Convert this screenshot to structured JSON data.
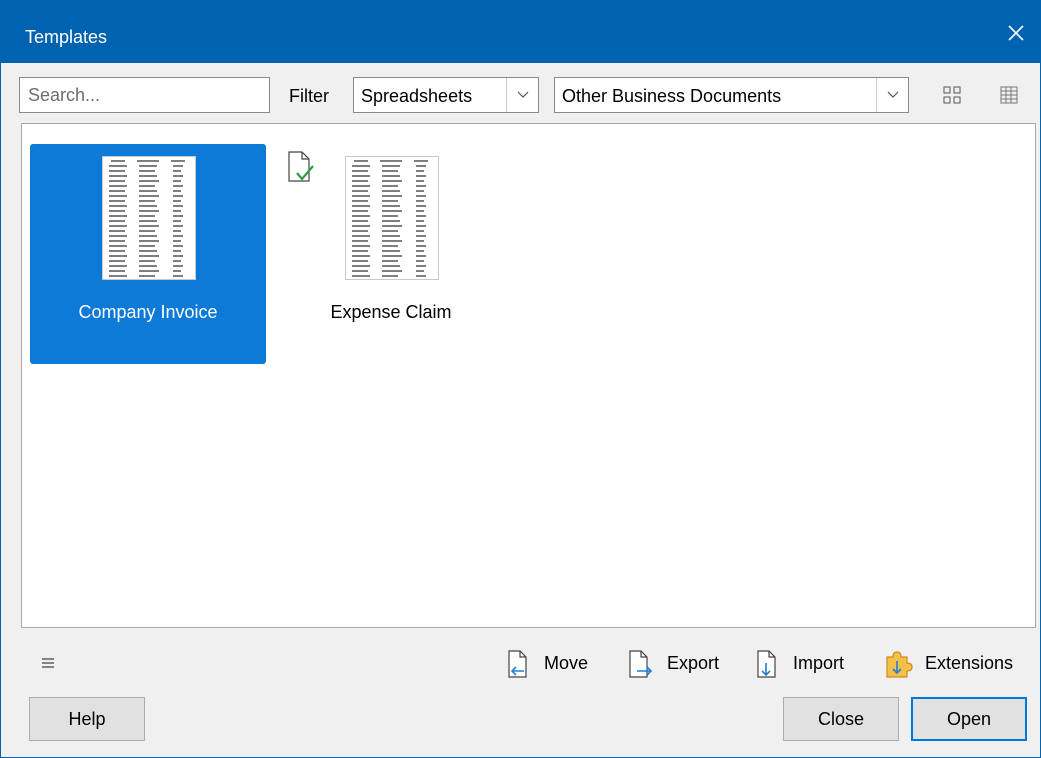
{
  "window": {
    "title": "Templates"
  },
  "toolbar": {
    "search_placeholder": "Search...",
    "search_value": "",
    "filter_label": "Filter",
    "type_filter": "Spreadsheets",
    "category_filter": "Other Business Documents"
  },
  "templates": [
    {
      "name": "Company Invoice",
      "selected": true,
      "default": false
    },
    {
      "name": "Expense Claim",
      "selected": false,
      "default": true
    }
  ],
  "actions": {
    "move": "Move",
    "export": "Export",
    "import": "Import",
    "extensions": "Extensions"
  },
  "buttons": {
    "help": "Help",
    "close": "Close",
    "open": "Open"
  },
  "colors": {
    "titlebar": "#0063b1",
    "selection": "#0d7ad7",
    "default_button_border": "#0078d7"
  }
}
